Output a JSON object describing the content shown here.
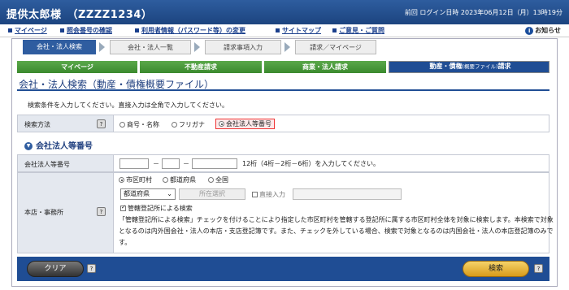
{
  "header": {
    "user_name": "提供太郎様　（ZZZZ1234）",
    "last_login": "前回 ログイン日時 2023年06月12日（月）13時19分"
  },
  "links": {
    "items": [
      "マイページ",
      "照会番号の確認",
      "利用者情報（パスワード等）の変更",
      "サイトマップ",
      "ご意見・ご質問"
    ],
    "notice": "お知らせ"
  },
  "steps": [
    "会社・法人検索",
    "会社・法人一覧",
    "請求事項入力",
    "請求／マイページ"
  ],
  "tabs": {
    "mypage": "マイページ",
    "realestate": "不動産請求",
    "commercial": "商業・法人請求",
    "movable_main": "動産・債権",
    "movable_sub": "(概要ファイル)",
    "movable_tail": "請求"
  },
  "page_title": "会社・法人検索（動産・債権概要ファイル）",
  "instruction": "検索条件を入力してください。直接入力は全角で入力してください。",
  "search_method": {
    "label": "検索方法",
    "help": "?",
    "options": [
      "商号・名称",
      "フリガナ",
      "会社法人等番号"
    ],
    "selected": "会社法人等番号"
  },
  "section_title": "会社法人等番号",
  "corp_number": {
    "label": "会社法人等番号",
    "sep": "－",
    "note": "12桁（4桁－2桁－6桁）を入力してください。"
  },
  "office": {
    "label": "本店・事務所",
    "help": "?",
    "scope_options": [
      "市区町村",
      "都道府県",
      "全国"
    ],
    "prefecture_placeholder": "都道府県",
    "location_button": "所在選択",
    "direct_input_label": "直接入力",
    "jurisdiction_label": "管轄登記所による検索",
    "description": "「管轄登記所による検索」チェックを付けることにより指定した市区町村を管轄する登記所に属する市区町村全体を対象に検索します。本検索で対象となるのは内外国会社・法人の本店・支店登記簿です。また、チェックを外している場合、検索で対象となるのは内国会社・法人の本店登記簿のみです。"
  },
  "footer": {
    "clear_label": "クリア",
    "search_label": "検索",
    "help": "?"
  }
}
